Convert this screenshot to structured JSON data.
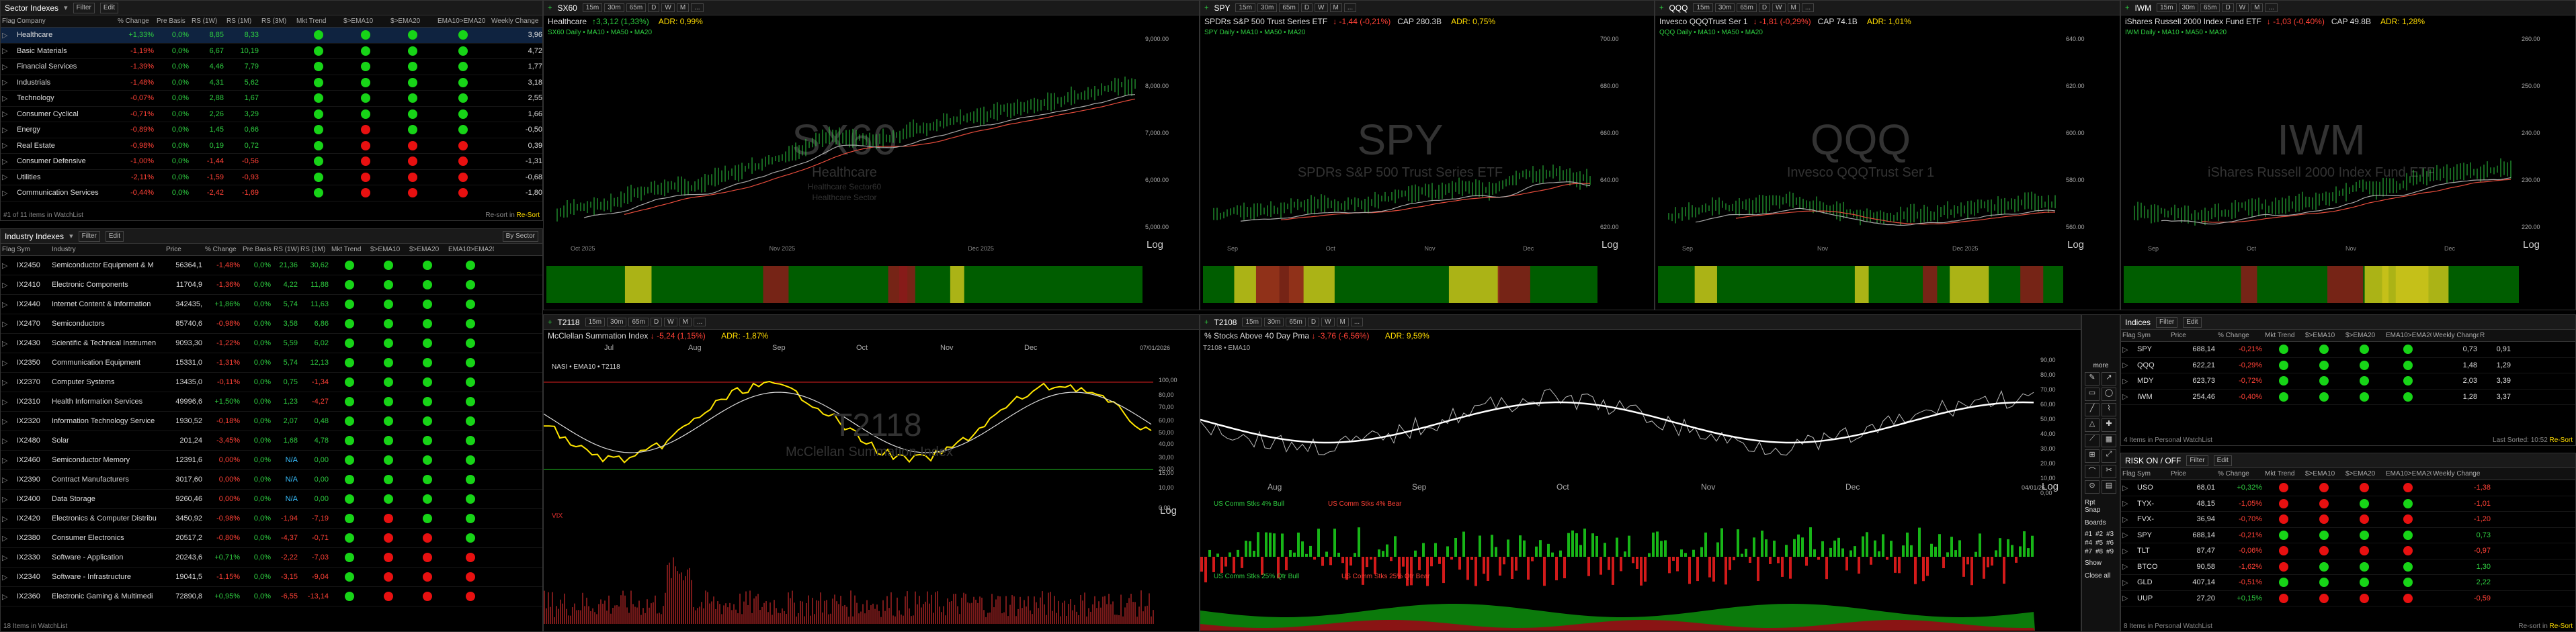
{
  "sector": {
    "title": "Sector Indexes",
    "filter": "Filter",
    "edit": "Edit",
    "cols": [
      "Flag",
      "Company",
      "% Change",
      "Pre Basis",
      "RS (1W)",
      "RS (1M)",
      "RS (3M)",
      "Mkt Trend",
      "$>EMA10",
      "$>EMA20",
      "EMA10>EMA20",
      "Weekly Change"
    ],
    "rows": [
      {
        "name": "Healthcare",
        "chg": "+1,33%",
        "pre": "0,0%",
        "rs1w": "8,85",
        "rs1m": "8,33",
        "wk": "3,96",
        "dots": "gggg"
      },
      {
        "name": "Basic Materials",
        "chg": "-1,19%",
        "pre": "0,0%",
        "rs1w": "6,67",
        "rs1m": "10,19",
        "wk": "4,72",
        "dots": "gggg"
      },
      {
        "name": "Financial Services",
        "chg": "-1,39%",
        "pre": "0,0%",
        "rs1w": "4,46",
        "rs1m": "7,79",
        "wk": "1,77",
        "dots": "gggg"
      },
      {
        "name": "Industrials",
        "chg": "-1,48%",
        "pre": "0,0%",
        "rs1w": "4,31",
        "rs1m": "5,62",
        "wk": "3,18",
        "dots": "gggg"
      },
      {
        "name": "Technology",
        "chg": "-0,07%",
        "pre": "0,0%",
        "rs1w": "2,88",
        "rs1m": "1,67",
        "wk": "2,55",
        "dots": "gggg"
      },
      {
        "name": "Consumer Cyclical",
        "chg": "-0,71%",
        "pre": "0,0%",
        "rs1w": "2,26",
        "rs1m": "3,29",
        "wk": "1,66",
        "dots": "gggg"
      },
      {
        "name": "Energy",
        "chg": "-0,89%",
        "pre": "0,0%",
        "rs1w": "1,45",
        "rs1m": "0,66",
        "wk": "-0,50",
        "dots": "grgg"
      },
      {
        "name": "Real Estate",
        "chg": "-0,98%",
        "pre": "0,0%",
        "rs1w": "0,19",
        "rs1m": "0,72",
        "wk": "0,39",
        "dots": "grrr"
      },
      {
        "name": "Consumer Defensive",
        "chg": "-1,00%",
        "pre": "0,0%",
        "rs1w": "-1,44",
        "rs1m": "-0,56",
        "wk": "-1,31",
        "dots": "grrr"
      },
      {
        "name": "Utilities",
        "chg": "-2,11%",
        "pre": "0,0%",
        "rs1w": "-1,59",
        "rs1m": "-0,93",
        "wk": "-0,68",
        "dots": "grrr"
      },
      {
        "name": "Communication Services",
        "chg": "-0,44%",
        "pre": "0,0%",
        "rs1w": "-2,42",
        "rs1m": "-1,69",
        "wk": "-1,80",
        "dots": "grrr"
      }
    ],
    "status": "#1 of 11 items in WatchList",
    "footer": "Re-sort in",
    "footer2": "Re-Sort"
  },
  "industry": {
    "title": "Industry Indexes",
    "filter": "Filter",
    "edit": "Edit",
    "bySector": "By Sector",
    "cols": [
      "Flag",
      "Sym",
      "Industry",
      "Price",
      "% Change",
      "Pre Basis",
      "RS (1W)",
      "RS (1M)",
      "Mkt Trend",
      "$>EMA10",
      "$>EMA20",
      "EMA10>EMA20"
    ],
    "rows": [
      {
        "sym": "IX2450",
        "ind": "Semiconductor Equipment & M",
        "price": "56364,1",
        "chg": "-1,48%",
        "pre": "0,0%",
        "a": "21,36",
        "b": "30,62",
        "dots": "gggg"
      },
      {
        "sym": "IX2410",
        "ind": "Electronic Components",
        "price": "11704,9",
        "chg": "-1,36%",
        "pre": "0,0%",
        "a": "4,22",
        "b": "11,88",
        "dots": "gggg"
      },
      {
        "sym": "IX2440",
        "ind": "Internet Content & Information",
        "price": "342435,",
        "chg": "+1,86%",
        "pre": "0,0%",
        "a": "5,74",
        "b": "11,63",
        "dots": "gggg"
      },
      {
        "sym": "IX2470",
        "ind": "Semiconductors",
        "price": "85740,6",
        "chg": "-0,98%",
        "pre": "0,0%",
        "a": "3,58",
        "b": "6,86",
        "dots": "gggg"
      },
      {
        "sym": "IX2430",
        "ind": "Scientific & Technical Instrumen",
        "price": "9093,30",
        "chg": "-1,22%",
        "pre": "0,0%",
        "a": "5,59",
        "b": "6,02",
        "dots": "gggg"
      },
      {
        "sym": "IX2350",
        "ind": "Communication Equipment",
        "price": "15331,0",
        "chg": "-1,31%",
        "pre": "0,0%",
        "a": "5,74",
        "b": "12,13",
        "dots": "gggg"
      },
      {
        "sym": "IX2370",
        "ind": "Computer Systems",
        "price": "13435,0",
        "chg": "-0,11%",
        "pre": "0,0%",
        "a": "0,75",
        "b": "-1,34",
        "dots": "gggg"
      },
      {
        "sym": "IX2310",
        "ind": "Health Information Services",
        "price": "49996,6",
        "chg": "+1,50%",
        "pre": "0,0%",
        "a": "1,23",
        "b": "-4,27",
        "dots": "gggg"
      },
      {
        "sym": "IX2320",
        "ind": "Information Technology Service",
        "price": "1930,52",
        "chg": "-0,18%",
        "pre": "0,0%",
        "a": "2,07",
        "b": "0,48",
        "dots": "gggg"
      },
      {
        "sym": "IX2480",
        "ind": "Solar",
        "price": "201,24",
        "chg": "-3,45%",
        "pre": "0,0%",
        "a": "1,68",
        "b": "4,78",
        "dots": "gggg"
      },
      {
        "sym": "IX2460",
        "ind": "Semiconductor Memory",
        "price": "12391,6",
        "chg": "0,00%",
        "pre": "0,0%",
        "a": "N/A",
        "b": "0,00",
        "dots": "gggg"
      },
      {
        "sym": "IX2390",
        "ind": "Contract Manufacturers",
        "price": "3017,60",
        "chg": "0,00%",
        "pre": "0,0%",
        "a": "N/A",
        "b": "0,00",
        "dots": "gggg"
      },
      {
        "sym": "IX2400",
        "ind": "Data Storage",
        "price": "9260,46",
        "chg": "0,00%",
        "pre": "0,0%",
        "a": "N/A",
        "b": "0,00",
        "dots": "gggg"
      },
      {
        "sym": "IX2420",
        "ind": "Electronics & Computer Distribu",
        "price": "3450,92",
        "chg": "-0,98%",
        "pre": "0,0%",
        "a": "-1,94",
        "b": "-7,19",
        "dots": "grgg"
      },
      {
        "sym": "IX2380",
        "ind": "Consumer Electronics",
        "price": "20517,2",
        "chg": "-0,80%",
        "pre": "0,0%",
        "a": "-4,37",
        "b": "-0,71",
        "dots": "grrg"
      },
      {
        "sym": "IX2330",
        "ind": "Software - Application",
        "price": "20243,6",
        "chg": "+0,71%",
        "pre": "0,0%",
        "a": "-2,22",
        "b": "-7,03",
        "dots": "grrr"
      },
      {
        "sym": "IX2340",
        "ind": "Software - Infrastructure",
        "price": "19041,5",
        "chg": "-1,15%",
        "pre": "0,0%",
        "a": "-3,15",
        "b": "-9,04",
        "dots": "grrr"
      },
      {
        "sym": "IX2360",
        "ind": "Electronic Gaming & Multimedi",
        "price": "72890,8",
        "chg": "+0,95%",
        "pre": "0,0%",
        "a": "-6,55",
        "b": "-13,14",
        "dots": "grrr"
      }
    ],
    "status": "18 Items in WatchList"
  },
  "charts": [
    {
      "sym": "SX60",
      "name": "Healthcare",
      "chg": "↑3,3,12 (1,33%)",
      "adr": "ADR: 0,99%",
      "legend": "SX60 Daily • MA10 • MA50 • MA20",
      "wm": "SX60",
      "wm2": "Healthcare",
      "wm3": "Healthcare Sector60",
      "wm4": "Healthcare Sector",
      "xlabels": [
        "Oct 2025",
        "Nov 2025",
        "Dec 2025"
      ],
      "yr": [
        "9,000.00",
        "8,000.00",
        "7,000.00",
        "6,000.00",
        "5,000.00"
      ]
    },
    {
      "sym": "SPY",
      "name": "SPDRs S&P 500 Trust Series ETF",
      "chg": "↓ -1,44 (-0,21%)",
      "cap": "CAP 280.3B",
      "adr": "ADR: 0,75%",
      "legend": "SPY Daily • MA10 • MA50 • MA20",
      "wm": "SPY",
      "wm2": "SPDRs S&P 500 Trust Series ETF",
      "xlabels": [
        "Sep",
        "Oct",
        "Nov",
        "Dec"
      ],
      "yr": [
        "700.00",
        "680.00",
        "660.00",
        "640.00",
        "620.00"
      ]
    },
    {
      "sym": "QQQ",
      "name": "Invesco QQQTrust Ser 1",
      "chg": "↓ -1,81 (-0,29%)",
      "cap": "CAP 74.1B",
      "adr": "ADR: 1,01%",
      "legend": "QQQ Daily • MA10 • MA50 • MA20",
      "wm": "QQQ",
      "wm2": "Invesco QQQTrust Ser 1",
      "xlabels": [
        "Sep",
        "Nov",
        "Dec 2025"
      ],
      "yr": [
        "640.00",
        "620.00",
        "600.00",
        "580.00",
        "560.00"
      ]
    },
    {
      "sym": "IWM",
      "name": "iShares Russell 2000 Index Fund ETF",
      "chg": "↓ -1,03 (-0,40%)",
      "cap": "CAP 49.8B",
      "adr": "ADR: 1,28%",
      "legend": "IWM Daily • MA10 • MA50 • MA20",
      "wm": "IWM",
      "wm2": "iShares Russell 2000 Index Fund ETF",
      "xlabels": [
        "Sep",
        "Oct",
        "Nov",
        "Dec"
      ],
      "yr": [
        "260.00",
        "250.00",
        "240.00",
        "230.00",
        "220.00"
      ]
    }
  ],
  "mcc": {
    "sym": "T2118",
    "name": "McClellan Summation Index",
    "chg": "↓ -5,24 (1,15%)",
    "adr": "ADR: -1,87%",
    "legend": "NASI • EMA10 • T2118",
    "wm": "T2118",
    "wm2": "McClellan Summation Index",
    "months": [
      "Jul",
      "Aug",
      "Sep",
      "Oct",
      "Nov",
      "Dec"
    ],
    "levels": [
      "100,00",
      "80,00",
      "70,00",
      "60,00",
      "50,00",
      "40,00",
      "30,00",
      "20,00",
      "15,00",
      "10,00",
      "0,00"
    ],
    "date": "07/01/2026",
    "sub": "VIX"
  },
  "pct": {
    "sym": "T2108",
    "name": "% Stocks Above 40 Day Pma",
    "chg": "↓ -3,76 (-6,56%)",
    "adr": "ADR: 9,59%",
    "legend": "T2108 • EMA10",
    "months": [
      "Aug",
      "Sep",
      "Oct",
      "Nov",
      "Dec"
    ],
    "levels": [
      "90,00",
      "80,00",
      "70,00",
      "60,00",
      "50,00",
      "40,00",
      "30,00",
      "20,00",
      "10,00",
      "0,00"
    ],
    "bull1": "US Comm Stks 4% Bull",
    "bear1": "US Comm Stks 4% Bear",
    "bull2": "US Comm Stks 25% Qtr Bull",
    "bear2": "US Comm Stks 25% Qtr Bear",
    "date": "04/01/26"
  },
  "idx": {
    "title": "Indices",
    "filter": "Filter",
    "edit": "Edit",
    "cols": [
      "Flag",
      "Sym",
      "Price",
      "% Change",
      "Mkt Trend",
      "$>EMA10",
      "$>EMA20",
      "EMA10>EMA20",
      "Weekly Change",
      "R"
    ],
    "rows": [
      {
        "sym": "SPY",
        "price": "688,14",
        "chg": "-0,21%",
        "wk": "0,73",
        "r": "0,91",
        "dots": "gggg"
      },
      {
        "sym": "QQQ",
        "price": "622,21",
        "chg": "-0,29%",
        "wk": "1,48",
        "r": "1,29",
        "dots": "gggg"
      },
      {
        "sym": "MDY",
        "price": "623,73",
        "chg": "-0,72%",
        "wk": "2,03",
        "r": "3,39",
        "dots": "gggg"
      },
      {
        "sym": "IWM",
        "price": "254,46",
        "chg": "-0,40%",
        "wk": "1,28",
        "r": "3,37",
        "dots": "gggg"
      }
    ],
    "status": "4 Items in Personal WatchList",
    "footer": "Last Sorted: 10:52",
    "footer2": "Re-Sort"
  },
  "risk": {
    "title": "RISK ON / OFF",
    "filter": "Filter",
    "edit": "Edit",
    "cols": [
      "Flag",
      "Sym",
      "Price",
      "% Change",
      "Mkt Trend",
      "$>EMA10",
      "$>EMA20",
      "EMA10>EMA20",
      "Weekly Change"
    ],
    "rows": [
      {
        "sym": "USO",
        "price": "68,01",
        "chg": "+0,32%",
        "wk": "-1,38",
        "dots": "rrrr"
      },
      {
        "sym": "TYX-",
        "price": "48,15",
        "chg": "-1,05%",
        "wk": "-1,01",
        "dots": "rrgg"
      },
      {
        "sym": "FVX-",
        "price": "36,94",
        "chg": "-0,70%",
        "wk": "-1,20",
        "dots": "rrrr"
      },
      {
        "sym": "SPY",
        "price": "688,14",
        "chg": "-0,21%",
        "wk": "0,73",
        "dots": "gggg"
      },
      {
        "sym": "TLT",
        "price": "87,47",
        "chg": "-0,06%",
        "wk": "-0,97",
        "dots": "rrrr"
      },
      {
        "sym": "BTCO",
        "price": "90,58",
        "chg": "-1,62%",
        "wk": "1,30",
        "dots": "rggg"
      },
      {
        "sym": "GLD",
        "price": "407,14",
        "chg": "-0,51%",
        "wk": "2,22",
        "dots": "gggg"
      },
      {
        "sym": "UUP",
        "price": "27,20",
        "chg": "+0,15%",
        "wk": "-0,59",
        "dots": "rrrr"
      }
    ],
    "status": "8 Items in Personal WatchList",
    "footer": "Re-sort in",
    "footer2": "Re-Sort"
  },
  "tools": {
    "title": "more",
    "links": [
      "Rpt",
      "Snap"
    ],
    "boards": "Boards",
    "nums": [
      "#1",
      "#2",
      "#3",
      "#4",
      "#5",
      "#6",
      "#7",
      "#8",
      "#9"
    ],
    "show": "Show",
    "close": "Close all"
  },
  "timeframes": [
    "15m",
    "30m",
    "65m",
    "D",
    "W",
    "M",
    "..."
  ],
  "log": "Log"
}
